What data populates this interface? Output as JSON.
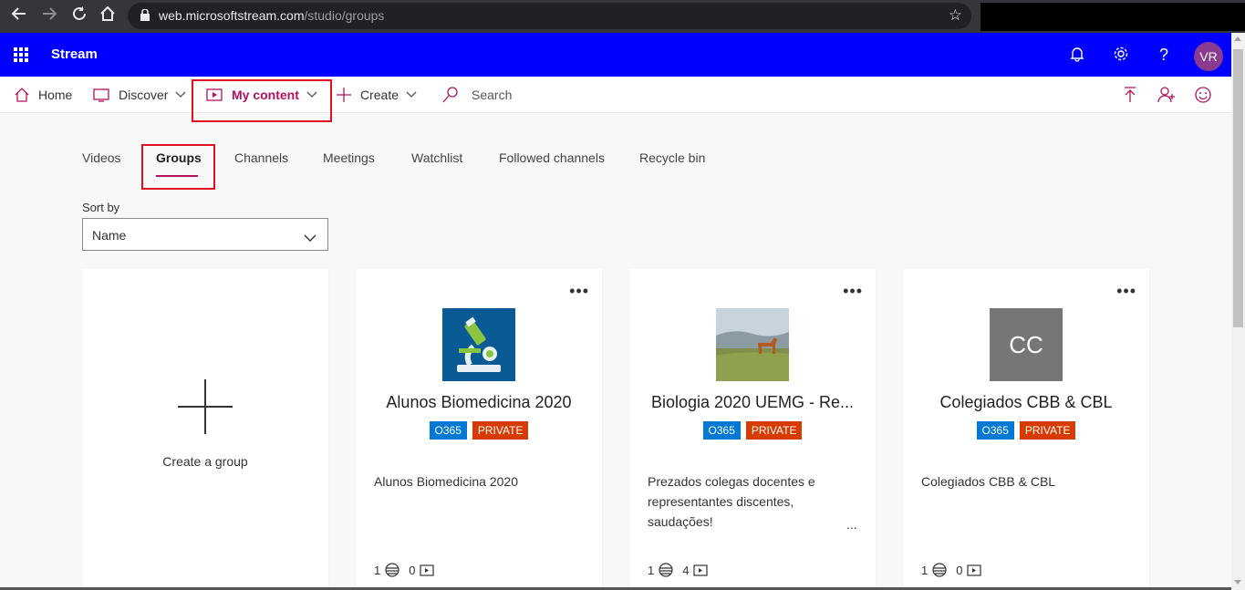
{
  "browser": {
    "url_host": "web.microsoftstream.com",
    "url_path": "/studio/groups"
  },
  "appbar": {
    "brand": "Stream",
    "avatar_initials": "VR",
    "color": "#0000ff"
  },
  "cmdbar": {
    "home": "Home",
    "discover": "Discover",
    "my_content": "My content",
    "create": "Create",
    "search_placeholder": "Search"
  },
  "tabs": [
    "Videos",
    "Groups",
    "Channels",
    "Meetings",
    "Watchlist",
    "Followed channels",
    "Recycle bin"
  ],
  "active_tab": "Groups",
  "sort": {
    "label": "Sort by",
    "value": "Name"
  },
  "create_card": {
    "label": "Create a group"
  },
  "groups": [
    {
      "title": "Alunos Biomedicina 2020",
      "badges": [
        "O365",
        "PRIVATE"
      ],
      "description": "Alunos Biomedicina 2020",
      "members": "1",
      "videos": "0",
      "thumb": "microscope-image"
    },
    {
      "title": "Biologia 2020 UEMG - Re...",
      "badges": [
        "O365",
        "PRIVATE"
      ],
      "description": "Prezados colegas docentes e representantes discentes, saudações!",
      "more": "...",
      "members": "1",
      "videos": "4",
      "thumb": "landscape-photo"
    },
    {
      "title": "Colegiados CBB & CBL",
      "badges": [
        "O365",
        "PRIVATE"
      ],
      "description": "Colegiados CBB & CBL",
      "members": "1",
      "videos": "0",
      "thumb_text": "CC"
    }
  ]
}
